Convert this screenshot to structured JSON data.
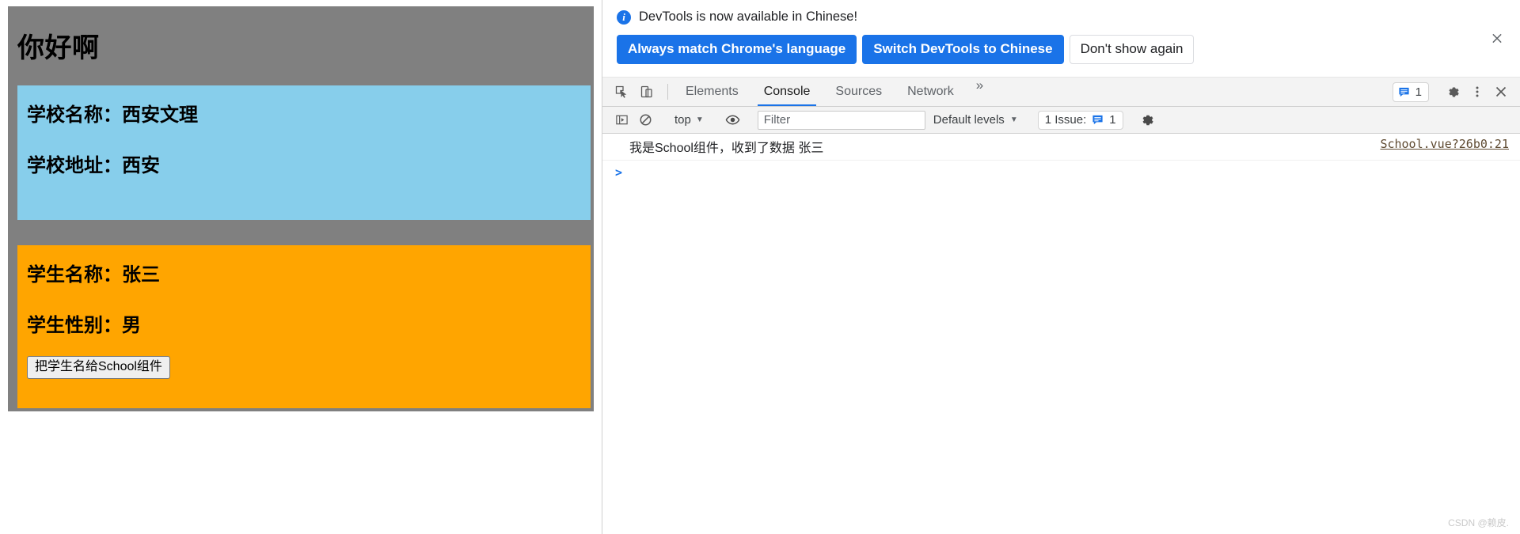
{
  "page": {
    "title": "你好啊",
    "school_card": {
      "name_label": "学校名称：",
      "name_value": "西安文理",
      "address_label": "学校地址：",
      "address_value": "西安",
      "bg_color": "#87ceeb"
    },
    "student_card": {
      "name_label": "学生名称：",
      "name_value": "张三",
      "gender_label": "学生性别：",
      "gender_value": "男",
      "button_label": "把学生名给School组件",
      "bg_color": "#ffa500"
    },
    "app_bg_color": "#808080"
  },
  "devtools": {
    "banner": {
      "message": "DevTools is now available in Chinese!",
      "info_icon": "info-icon",
      "buttons": [
        {
          "label": "Always match Chrome's language",
          "style": "primary"
        },
        {
          "label": "Switch DevTools to Chinese",
          "style": "primary"
        },
        {
          "label": "Don't show again",
          "style": "ghost"
        }
      ],
      "close_icon": "close-icon",
      "accent_color": "#1a73e8"
    },
    "tabbar": {
      "inspect_icon": "inspect-element-icon",
      "device_icon": "device-toolbar-icon",
      "tabs": [
        {
          "label": "Elements",
          "active": false
        },
        {
          "label": "Console",
          "active": true
        },
        {
          "label": "Sources",
          "active": false
        },
        {
          "label": "Network",
          "active": false
        }
      ],
      "overflow_label": "»",
      "messages_badge": {
        "icon": "message-icon",
        "count": "1"
      },
      "settings_icon": "gear-icon",
      "more_icon": "three-dot-menu-icon",
      "close_icon": "close-devtools-icon"
    },
    "console_toolbar": {
      "sidebar_icon": "console-sidebar-icon",
      "clear_icon": "clear-console-icon",
      "context": "top",
      "context_caret": "▼",
      "eye_icon": "live-expression-icon",
      "filter_placeholder": "Filter",
      "filter_value": "",
      "levels": "Default levels",
      "levels_caret": "▼",
      "issues_text": "1 Issue:",
      "issues_icon": "message-icon",
      "issues_count": "1",
      "settings_icon": "gear-icon"
    },
    "console": {
      "rows": [
        {
          "message": "我是School组件，收到了数据 张三",
          "source": "School.vue?26b0:21"
        }
      ],
      "prompt_caret": ">",
      "prompt_value": ""
    },
    "watermark": "CSDN @赖皮."
  }
}
